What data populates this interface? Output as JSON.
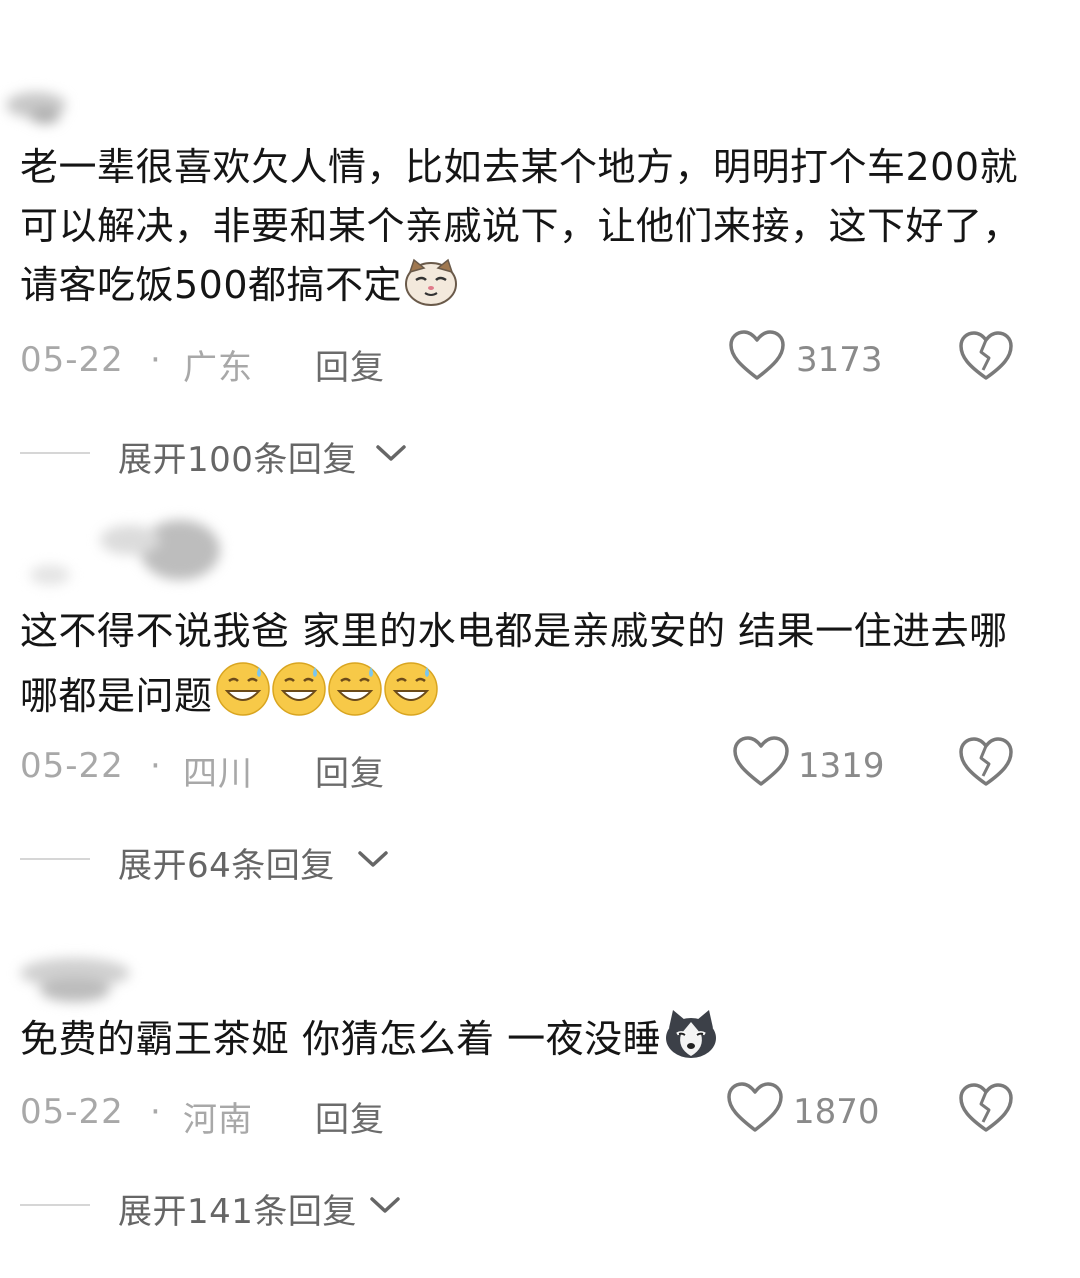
{
  "comments": [
    {
      "text": "老一辈很喜欢欠人情，比如去某个地方，明明打个车200就可以解决，非要和某个亲戚说下，让他们来接，这下好了，请客吃饭500都搞不定",
      "emoji": "cat-face-emoji",
      "date": "05-22",
      "separator": "·",
      "region": "广东",
      "reply_label": "回复",
      "likes": "3173",
      "expand_label": "展开100条回复"
    },
    {
      "text": "这不得不说我爸 家里的水电都是亲戚安的 结果一住进去哪哪都是问题",
      "emoji": "sweat-grin-emoji",
      "date": "05-22",
      "separator": "·",
      "region": "四川",
      "reply_label": "回复",
      "likes": "1319",
      "expand_label": "展开64条回复"
    },
    {
      "text": "免费的霸王茶姬 你猜怎么着 一夜没睡",
      "emoji": "husky-face-emoji",
      "date": "05-22",
      "separator": "·",
      "region": "河南",
      "reply_label": "回复",
      "likes": "1870",
      "expand_label": "展开141条回复"
    }
  ],
  "colors": {
    "text": "#151515",
    "meta": "#a8a8a8",
    "reply": "#6b6b6b",
    "icon": "#7a7a7a",
    "expand": "#666666"
  }
}
